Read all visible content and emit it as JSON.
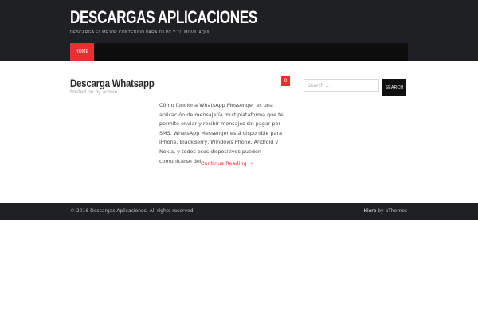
{
  "header": {
    "site_title": "DESCARGAS APLICACIONES",
    "tagline": "DESCARGA EL MEJOR CONTENIDO PARA TU PC Y TU MOVIL AQUI!"
  },
  "nav": {
    "items": [
      {
        "label": "HOME",
        "active": true
      }
    ]
  },
  "post": {
    "title": "Descarga Whatsapp",
    "meta": "Posted on by admin",
    "comment_count": "0",
    "excerpt": "Cómo funciona WhatsApp Messenger es una aplicación de mensajería multiplataforma que te permite enviar y recibir mensajes sin pagar por SMS. WhatsApp Messenger está disponible para iPhone, BlackBerry, Windows Phone, Android y Nokia, y todos esos dispositivos pueden comunicarse del…",
    "continue_label": "Continue Reading →"
  },
  "sidebar": {
    "search_placeholder": "Search ...",
    "search_button": "SEARCH"
  },
  "footer": {
    "copyright": "© 2016 Descargas Aplicaciones. All rights reserved.",
    "theme_name": "Hiero",
    "credit_suffix": " by aThemes"
  },
  "colors": {
    "accent": "#e83030",
    "header_bg": "#1f2024",
    "nav_bg": "#0d0d0d"
  }
}
